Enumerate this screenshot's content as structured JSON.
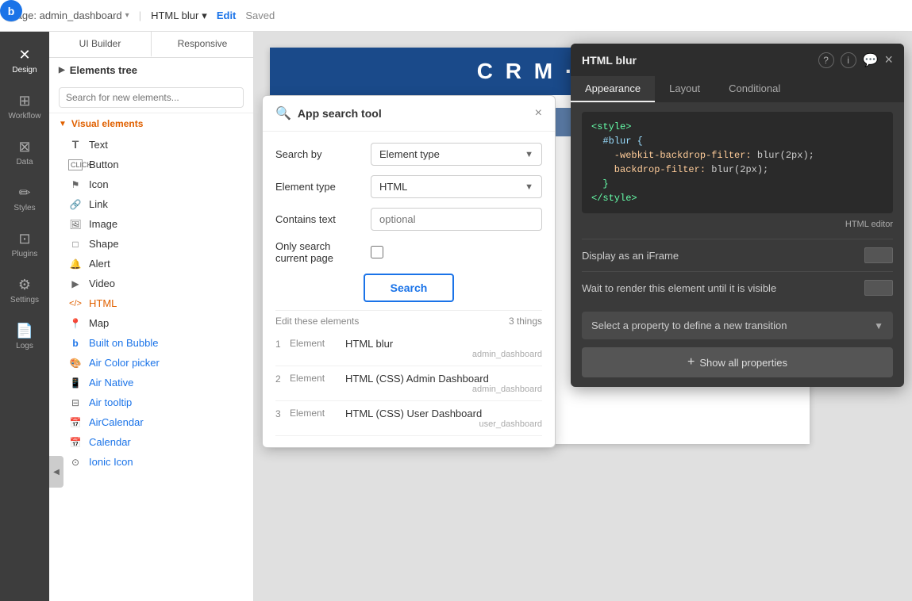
{
  "topbar": {
    "logo_text": "b",
    "page_label": "Page: admin_dashboard",
    "chevron": "▾",
    "workflow_label": "HTML blur",
    "edit_label": "Edit",
    "saved_label": "Saved"
  },
  "sidebar": {
    "items": [
      {
        "id": "design",
        "icon": "✕",
        "label": "Design",
        "active": true
      },
      {
        "id": "workflow",
        "icon": "⊞",
        "label": "Workflow"
      },
      {
        "id": "data",
        "icon": "⊠",
        "label": "Data"
      },
      {
        "id": "styles",
        "icon": "✏",
        "label": "Styles"
      },
      {
        "id": "plugins",
        "icon": "⊡",
        "label": "Plugins"
      },
      {
        "id": "settings",
        "icon": "⚙",
        "label": "Settings"
      },
      {
        "id": "logs",
        "icon": "📄",
        "label": "Logs"
      }
    ]
  },
  "elements_panel": {
    "tabs": [
      {
        "id": "ui-builder",
        "label": "UI Builder",
        "active": false
      },
      {
        "id": "responsive",
        "label": "Responsive",
        "active": false
      }
    ],
    "elements_tree_label": "Elements tree",
    "search_placeholder": "Search for new elements...",
    "visual_elements_label": "Visual elements",
    "elements": [
      {
        "id": "text",
        "icon": "T",
        "label": "Text"
      },
      {
        "id": "button",
        "icon": "▣",
        "label": "Button"
      },
      {
        "id": "icon",
        "icon": "⚑",
        "label": "Icon"
      },
      {
        "id": "link",
        "icon": "🔗",
        "label": "Link"
      },
      {
        "id": "image",
        "icon": "🖼",
        "label": "Image"
      },
      {
        "id": "shape",
        "icon": "□",
        "label": "Shape"
      },
      {
        "id": "alert",
        "icon": "🔔",
        "label": "Alert"
      },
      {
        "id": "video",
        "icon": "▶",
        "label": "Video"
      },
      {
        "id": "html",
        "icon": "</>",
        "label": "HTML",
        "highlight": true
      },
      {
        "id": "map",
        "icon": "📍",
        "label": "Map"
      },
      {
        "id": "builtonbubble",
        "icon": "b",
        "label": "Built on Bubble",
        "plugin": true
      },
      {
        "id": "aircolorpicker",
        "icon": "🎨",
        "label": "Air Color picker",
        "plugin": true
      },
      {
        "id": "airnative",
        "icon": "📱",
        "label": "Air Native",
        "plugin": true
      },
      {
        "id": "airtooltip",
        "icon": "⊟",
        "label": "Air tooltip",
        "plugin": true
      },
      {
        "id": "aircalendar",
        "icon": "📅",
        "label": "AirCalendar",
        "plugin": true
      },
      {
        "id": "calendar",
        "icon": "📅",
        "label": "Calendar",
        "plugin": true
      },
      {
        "id": "ionicicon",
        "icon": "⊙",
        "label": "Ionic Icon",
        "plugin": true
      }
    ]
  },
  "canvas": {
    "logo_text": "C R M · Y"
  },
  "search_modal": {
    "title": "App search tool",
    "close_icon": "×",
    "search_by_label": "Search by",
    "search_by_value": "Element type",
    "element_type_label": "Element type",
    "element_type_value": "HTML",
    "contains_text_label": "Contains text",
    "contains_text_placeholder": "optional",
    "only_current_page_label": "Only search current page",
    "search_btn_label": "Search",
    "results_header_left": "Edit these elements",
    "results_count": "3 things",
    "results": [
      {
        "num": "1",
        "type": "Element",
        "name": "HTML blur",
        "page": "admin_dashboard"
      },
      {
        "num": "2",
        "type": "Element",
        "name": "HTML (CSS) Admin Dashboard",
        "page": "admin_dashboard"
      },
      {
        "num": "3",
        "type": "Element",
        "name": "HTML (CSS) User Dashboard",
        "page": "user_dashboard"
      }
    ]
  },
  "blur_panel": {
    "title": "HTML blur",
    "actions": {
      "help": "?",
      "info": "i",
      "comment": "💬",
      "close": "×"
    },
    "tabs": [
      {
        "id": "appearance",
        "label": "Appearance",
        "active": true
      },
      {
        "id": "layout",
        "label": "Layout"
      },
      {
        "id": "conditional",
        "label": "Conditional"
      }
    ],
    "code_lines": [
      "<style>",
      "#blur {",
      "-webkit-backdrop-filter: blur(2px);",
      "backdrop-filter: blur(2px);",
      "}"
    ],
    "html_editor_label": "HTML editor",
    "display_iframe_label": "Display as an iFrame",
    "wait_render_label": "Wait to render this element until it is visible",
    "transition_placeholder": "Select a property to define a new transition",
    "show_all_label": "Show all properties"
  }
}
